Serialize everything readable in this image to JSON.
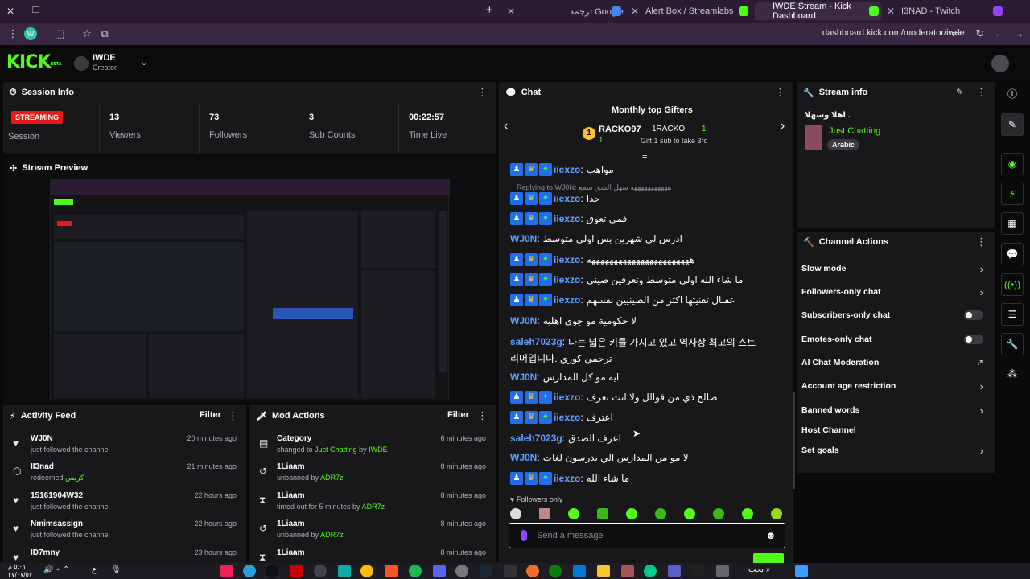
{
  "browser": {
    "tabs": [
      {
        "label": "ترجمة Google"
      },
      {
        "label": "Alert Box / Streamlabs"
      },
      {
        "label": "IWDE Stream - Kick Dashboard"
      },
      {
        "label": "I3NAD - Twitch"
      }
    ],
    "url": "dashboard.kick.com/moderator/iwde",
    "new_tab": "+"
  },
  "header": {
    "logo": "KICK",
    "logo_tag": "BETA",
    "channel_name": "IWDE",
    "channel_role": "Creator"
  },
  "session": {
    "title": "Session Info",
    "status": "STREAMING",
    "status_label": "Session",
    "stats": [
      {
        "value": "13",
        "label": "Viewers"
      },
      {
        "value": "73",
        "label": "Followers"
      },
      {
        "value": "3",
        "label": "Sub Counts"
      },
      {
        "value": "00:22:57",
        "label": "Time Live"
      }
    ]
  },
  "preview": {
    "title": "Stream Preview"
  },
  "activity": {
    "title": "Activity Feed",
    "filter": "Filter",
    "items": [
      {
        "name": "WJ0N",
        "detail": "just followed the channel",
        "time": "20 minutes ago"
      },
      {
        "name": "II3nad",
        "detail": "redeemed",
        "extra": "كريس",
        "time": "21 minutes ago"
      },
      {
        "name": "15161904W32",
        "detail": "just followed the channel",
        "time": "22 hours ago"
      },
      {
        "name": "Nmimsassign",
        "detail": "just followed the channel",
        "time": "22 hours ago"
      },
      {
        "name": "ID7mny",
        "detail": "",
        "time": "23 hours ago"
      }
    ]
  },
  "mod": {
    "title": "Mod Actions",
    "filter": "Filter",
    "items": [
      {
        "name": "Category",
        "detail": "changed to",
        "extra": "Just Chatting",
        "by": "by",
        "who": "IWDE",
        "time": "6 minutes ago"
      },
      {
        "name": "1Liaam",
        "detail": "unbanned by",
        "who": "ADR7z",
        "time": "8 minutes ago"
      },
      {
        "name": "1Liaam",
        "detail": "timed out for 5 minutes by",
        "who": "ADR7z",
        "time": "8 minutes ago"
      },
      {
        "name": "1Liaam",
        "detail": "unbanned by",
        "who": "ADR7z",
        "time": "8 minutes ago"
      },
      {
        "name": "1Liaam",
        "detail": "",
        "time": "8 minutes ago"
      }
    ]
  },
  "chat": {
    "title": "Chat",
    "gifters_title": "Monthly top Gifters",
    "gifter1": {
      "rank": "1",
      "name": "RACKO97",
      "count": "1"
    },
    "gifter2": {
      "name": "1RACKO",
      "count": "1",
      "note": "Gift 1 sub to take 3rd"
    },
    "reply_note": "Replying to WJ0N: هههههههههههه سهل الشق سمع",
    "messages": [
      {
        "user": "iiexzo",
        "color": "#5ea0ff",
        "badges": true,
        "text": "مواهب"
      },
      {
        "user": "iiexzo",
        "color": "#5ea0ff",
        "badges": true,
        "text": "جدا"
      },
      {
        "user": "iiexzo",
        "color": "#5ea0ff",
        "badges": true,
        "text": "فمي تعوق"
      },
      {
        "user": "WJ0N",
        "color": "#5ea0ff",
        "badges": false,
        "text": "ادرس لي شهرين بس اولى متوسط"
      },
      {
        "user": "iiexzo",
        "color": "#5ea0ff",
        "badges": true,
        "text": "هههههههههههههههههههههههه"
      },
      {
        "user": "iiexzo",
        "color": "#5ea0ff",
        "badges": true,
        "text": "ما شاء الله اولى متوسط وتعرفين صيني"
      },
      {
        "user": "iiexzo",
        "color": "#5ea0ff",
        "badges": true,
        "text": "عقبال تقنيتها اكثر من الصينيين نفسهم"
      },
      {
        "user": "WJ0N",
        "color": "#5ea0ff",
        "badges": false,
        "text": "لا حكومية مو جوي اهليه"
      },
      {
        "user": "saleh7023g",
        "color": "#5ea0ff",
        "badges": false,
        "text": "나는 넓은 키를 가지고 있고 역사상 최고의 스트",
        "text2": "리머입니다. ترجمي كوري"
      },
      {
        "user": "WJ0N",
        "color": "#5ea0ff",
        "badges": false,
        "text": "ايه مو كل المدارس"
      },
      {
        "user": "iiexzo",
        "color": "#5ea0ff",
        "badges": true,
        "text": "صالح ذي من قوالل ولا انت تعرف"
      },
      {
        "user": "iiexzo",
        "color": "#5ea0ff",
        "badges": true,
        "text": "اعترف"
      },
      {
        "user": "saleh7023g",
        "color": "#5ea0ff",
        "badges": false,
        "text": "اعرف الصدق"
      },
      {
        "user": "WJ0N",
        "color": "#5ea0ff",
        "badges": false,
        "text": "لا مو من المدارس الي يدرسون لغات"
      },
      {
        "user": "iiexzo",
        "color": "#5ea0ff",
        "badges": true,
        "text": "ما شاء الله"
      }
    ],
    "followers_only": "Followers only",
    "input_placeholder": "Send a message"
  },
  "stream_info": {
    "title": "Stream info",
    "stream_title": "اهلا وسهلا .",
    "category": "Just Chatting",
    "language": "Arabic"
  },
  "channel_actions": {
    "title": "Channel Actions",
    "items": [
      {
        "label": "Slow mode",
        "control": "chevron"
      },
      {
        "label": "Followers-only chat",
        "control": "chevron"
      },
      {
        "label": "Subscribers-only chat",
        "control": "toggle",
        "on": false
      },
      {
        "label": "Emotes-only chat",
        "control": "toggle",
        "on": false
      },
      {
        "label": "AI Chat Moderation",
        "control": "external"
      },
      {
        "label": "Account age restriction",
        "control": "chevron"
      },
      {
        "label": "Banned words",
        "control": "chevron"
      },
      {
        "label": "Host Channel",
        "control": "none"
      },
      {
        "label": "Set goals",
        "control": "chevron"
      }
    ]
  },
  "taskbar": {
    "clock_time": "٥:٠١ م",
    "clock_date": "٢٧/٠٧/٥٧",
    "lang": "ع",
    "search": "بحث"
  },
  "colors": {
    "accent": "#53fc18",
    "live": "#e91916",
    "panel": "#18181b",
    "bg": "#0a0a0b"
  }
}
